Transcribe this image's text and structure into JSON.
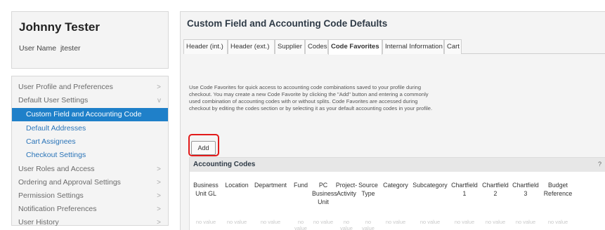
{
  "sidebar": {
    "user_full_name": "Johnny Tester",
    "user_name_label": "User Name",
    "user_name_value": "jtester",
    "nav": [
      {
        "label": "User Profile and Preferences",
        "chevron": ">"
      },
      {
        "label": "Default User Settings",
        "chevron": "v"
      },
      {
        "label": "Custom Field and Accounting Code Defaults"
      },
      {
        "label": "Default Addresses"
      },
      {
        "label": "Cart Assignees"
      },
      {
        "label": "Checkout Settings"
      },
      {
        "label": "User Roles and Access",
        "chevron": ">"
      },
      {
        "label": "Ordering and Approval Settings",
        "chevron": ">"
      },
      {
        "label": "Permission Settings",
        "chevron": ">"
      },
      {
        "label": "Notification Preferences",
        "chevron": ">"
      },
      {
        "label": "User History",
        "chevron": ">"
      }
    ]
  },
  "main": {
    "title": "Custom Field and Accounting Code Defaults",
    "tabs": [
      "Header (int.)",
      "Header (ext.)",
      "Supplier",
      "Codes",
      "Code Favorites",
      "Internal Information",
      "Cart"
    ],
    "active_tab": "Code Favorites",
    "description": [
      "Use Code Favorites for quick access to accounting code combinations saved to your profile during",
      "checkout. You may create a new Code Favorite by clicking the \"Add\" button and entering a commonly",
      "used combination of accounting codes with or without splits. Code Favorites are accessed during",
      "checkout by editing the codes section or by selecting it as your default accounting codes in your profile."
    ],
    "add_label": "Add",
    "accounting_codes": {
      "title": "Accounting Codes",
      "help": "?",
      "columns": [
        [
          "Business",
          "Unit GL"
        ],
        [
          "Location"
        ],
        [
          "Department"
        ],
        [
          "Fund"
        ],
        [
          "PC",
          "Business",
          "Unit"
        ],
        [
          "Project-",
          "Activity"
        ],
        [
          "Source",
          "Type"
        ],
        [
          "Category"
        ],
        [
          "Subcategory"
        ],
        [
          "Chartfield",
          "1"
        ],
        [
          "Chartfield",
          "2"
        ],
        [
          "Chartfield",
          "3"
        ],
        [
          "Budget",
          "Reference"
        ]
      ],
      "row_values": [
        [
          "no value"
        ],
        [
          "no value"
        ],
        [
          "no value"
        ],
        [
          "no",
          "value"
        ],
        [
          "no value"
        ],
        [
          "no",
          "value"
        ],
        [
          "no",
          "value"
        ],
        [
          "no value"
        ],
        [
          "no value"
        ],
        [
          "no value"
        ],
        [
          "no value"
        ],
        [
          "no value"
        ],
        [
          "no value"
        ]
      ]
    }
  }
}
